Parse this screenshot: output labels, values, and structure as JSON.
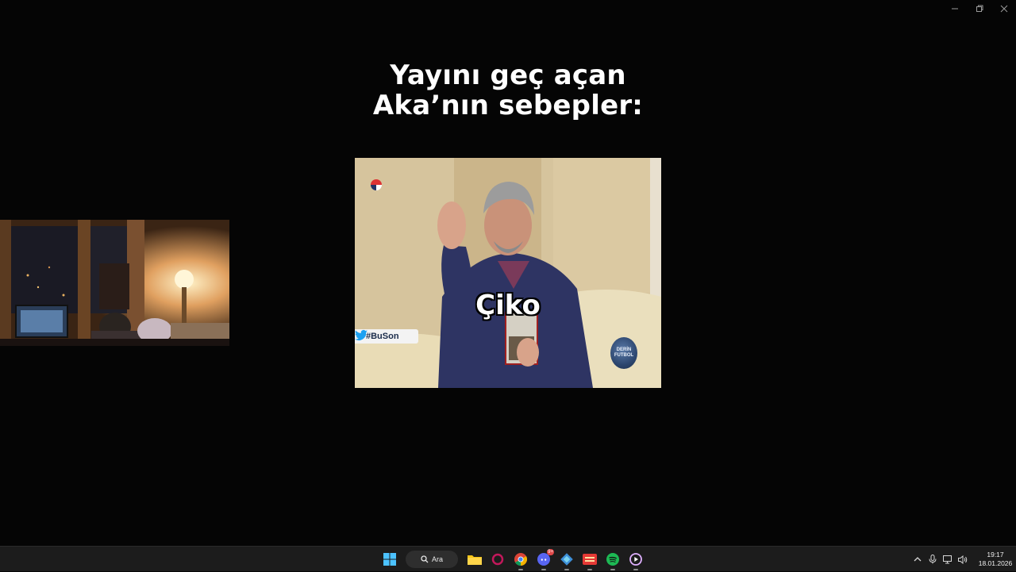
{
  "caption": {
    "line1": "Yayını geç açan",
    "line2": "Aka’nın sebepler:"
  },
  "video": {
    "overlay_word": "Çiko",
    "hashtag": "#BuSon",
    "channel_logo_line1": "DERİN",
    "channel_logo_line2": "FUTBOL"
  },
  "taskbar": {
    "search_label": "Ara",
    "discord_badge": "9+",
    "time": "19:17",
    "date": "18.01.2026"
  },
  "icons": {
    "start": "windows-start-icon",
    "search": "search-icon",
    "explorer": "folder-icon",
    "chrome": "chrome-icon",
    "discord": "discord-icon",
    "spotify": "spotify-icon"
  },
  "colors": {
    "background": "#050505",
    "taskbar": "#1c1c1c",
    "accent": "#4cc2ff"
  }
}
